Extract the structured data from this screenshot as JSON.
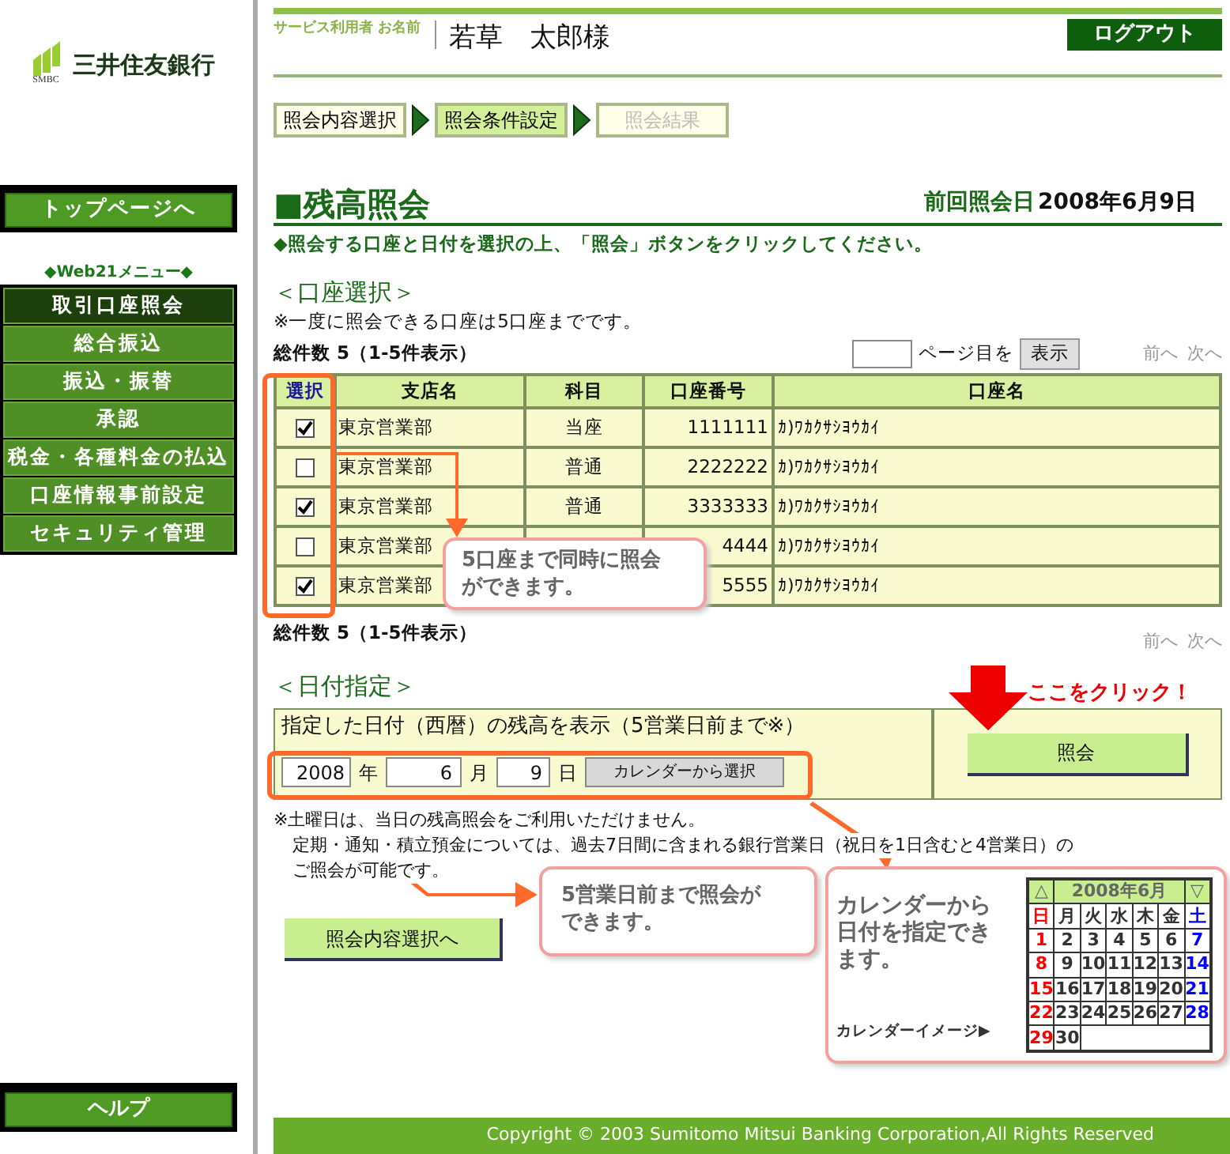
{
  "sidebar": {
    "logo_text": "三井住友銀行",
    "logo_sub": "SMBC",
    "top_button": "トップページへ",
    "menu_title": "◆Web21メニュー◆",
    "items": [
      {
        "label": "取引口座照会",
        "selected": true
      },
      {
        "label": "総合振込",
        "selected": false
      },
      {
        "label": "振込・振替",
        "selected": false
      },
      {
        "label": "承認",
        "selected": false
      },
      {
        "label": "税金・各種料金の払込",
        "selected": false
      },
      {
        "label": "口座情報事前設定",
        "selected": false
      },
      {
        "label": "セキュリティ管理",
        "selected": false
      }
    ],
    "help_button": "ヘルプ"
  },
  "header": {
    "user_label": "サービス利用者 お名前",
    "user_name": "若草　太郎様",
    "logout": "ログアウト"
  },
  "steps": [
    {
      "label": "照会内容選択",
      "selected": false,
      "disabled": false
    },
    {
      "label": "照会条件設定",
      "selected": true,
      "disabled": false
    },
    {
      "label": "照会結果",
      "selected": false,
      "disabled": true
    }
  ],
  "page": {
    "title": "■残高照会",
    "last_label": "前回照会日",
    "last_date": "2008年6月9日",
    "instruction": "◆照会する口座と日付を選択の上、「照会」ボタンをクリックしてください。"
  },
  "accounts": {
    "heading": "＜口座選択＞",
    "note": "※一度に照会できる口座は5口座までです。",
    "count": "総件数 5（1-5件表示）",
    "page_suffix": "ページ目を",
    "show_button": "表示",
    "prev": "前へ",
    "next": "次へ",
    "columns": [
      "選択",
      "支店名",
      "科目",
      "口座番号",
      "口座名"
    ],
    "rows": [
      {
        "checked": true,
        "branch": "東京営業部",
        "subject": "当座",
        "number": "1111111",
        "name": "ｶ)ﾜｶｸｻｼﾖｳｶｲ"
      },
      {
        "checked": false,
        "branch": "東京営業部",
        "subject": "普通",
        "number": "2222222",
        "name": "ｶ)ﾜｶｸｻｼﾖｳｶｲ"
      },
      {
        "checked": true,
        "branch": "東京営業部",
        "subject": "普通",
        "number": "3333333",
        "name": "ｶ)ﾜｶｸｻｼﾖｳｶｲ"
      },
      {
        "checked": false,
        "branch": "東京営業部",
        "number": "4444",
        "name": "ｶ)ﾜｶｸｻｼﾖｳｶｲ"
      },
      {
        "checked": true,
        "branch": "東京営業部",
        "number": "5555",
        "name": "ｶ)ﾜｶｸｻｼﾖｳｶｲ"
      }
    ],
    "count_bottom": "総件数 5（1-5件表示）",
    "prev_bottom": "前へ",
    "next_bottom": "次へ"
  },
  "date": {
    "heading": "＜日付指定＞",
    "label": "指定した日付（西暦）の残高を表示（5営業日前まで※）",
    "year": "2008",
    "year_unit": "年",
    "month": "6",
    "month_unit": "月",
    "day": "9",
    "day_unit": "日",
    "calendar_button": "カレンダーから選択",
    "submit": "照会",
    "click_hint": "ここをクリック！",
    "notes": [
      "※土曜日は、当日の残高照会をご利用いただけません。",
      "定期・通知・積立預金については、過去7日間に含まれる銀行営業日（祝日を1日含むと4営業日）の",
      "ご照会が可能です。"
    ],
    "back_button": "照会内容選択へ"
  },
  "callouts": {
    "accounts": "5口座まで同時に照会ができます。",
    "date": "5営業日前まで照会ができます。",
    "calendar": "カレンダーから日付を指定できます。",
    "calendar_caption": "カレンダーイメージ▶"
  },
  "calendar": {
    "title": "2008年6月",
    "prev": "△",
    "next": "▽",
    "weekdays": [
      {
        "label": "日",
        "color": "#ff0000"
      },
      {
        "label": "月",
        "color": "#333333"
      },
      {
        "label": "火",
        "color": "#333333"
      },
      {
        "label": "水",
        "color": "#333333"
      },
      {
        "label": "木",
        "color": "#333333"
      },
      {
        "label": "金",
        "color": "#333333"
      },
      {
        "label": "土",
        "color": "#0000ff"
      }
    ],
    "weeks": [
      [
        "1",
        "2",
        "3",
        "4",
        "5",
        "6",
        "7"
      ],
      [
        "8",
        "9",
        "10",
        "11",
        "12",
        "13",
        "14"
      ],
      [
        "15",
        "16",
        "17",
        "18",
        "19",
        "20",
        "21"
      ],
      [
        "22",
        "23",
        "24",
        "25",
        "26",
        "27",
        "28"
      ],
      [
        "29",
        "30"
      ]
    ]
  },
  "footer": "Copyright © 2003 Sumitomo Mitsui Banking Corporation,All Rights Reserved"
}
